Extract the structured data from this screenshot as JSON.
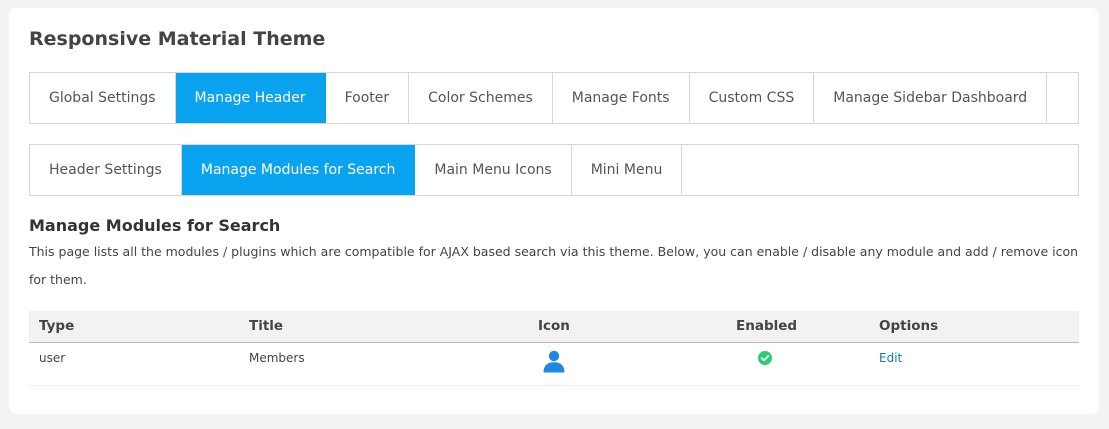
{
  "page": {
    "title": "Responsive Material Theme"
  },
  "main_tabs": [
    {
      "label": "Global Settings"
    },
    {
      "label": "Manage Header"
    },
    {
      "label": "Footer"
    },
    {
      "label": "Color Schemes"
    },
    {
      "label": "Manage Fonts"
    },
    {
      "label": "Custom CSS"
    },
    {
      "label": "Manage Sidebar Dashboard"
    }
  ],
  "sub_tabs": [
    {
      "label": "Header Settings"
    },
    {
      "label": "Manage Modules for Search"
    },
    {
      "label": "Main Menu Icons"
    },
    {
      "label": "Mini Menu"
    }
  ],
  "section": {
    "title": "Manage Modules for Search",
    "description": "This page lists all the modules / plugins which are compatible for AJAX based search via this theme. Below, you can enable / disable any module and add / remove icon for them."
  },
  "table": {
    "headers": {
      "type": "Type",
      "title": "Title",
      "icon": "Icon",
      "enabled": "Enabled",
      "options": "Options"
    },
    "rows": [
      {
        "type": "user",
        "title": "Members",
        "icon": "user-icon",
        "enabled": true,
        "option": "Edit"
      }
    ]
  },
  "colors": {
    "accent": "#0aa3ef",
    "enabled": "#2ecc71",
    "link": "#1a78c2",
    "user_icon": "#1e88e5"
  }
}
